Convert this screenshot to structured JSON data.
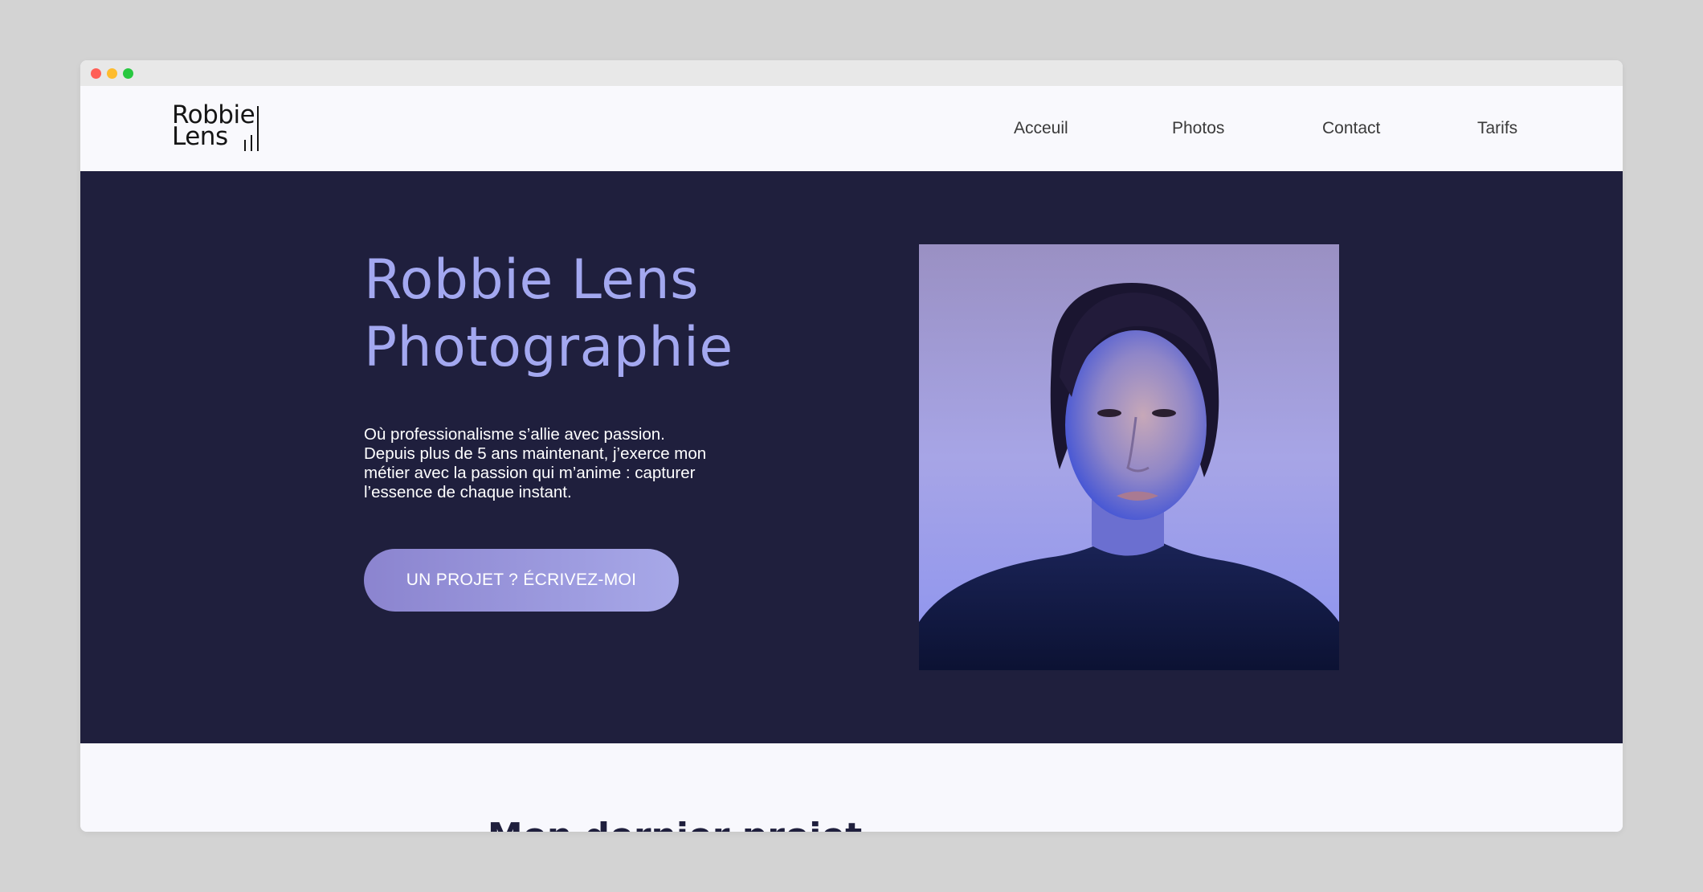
{
  "browser": {
    "controls": [
      "close",
      "minimize",
      "maximize"
    ],
    "colors": {
      "close": "#ff5f57",
      "minimize": "#febc2e",
      "maximize": "#28c840"
    }
  },
  "header": {
    "logo": {
      "line1": "Robbie",
      "line2": "Lens"
    },
    "nav": [
      {
        "label": "Acceuil"
      },
      {
        "label": "Photos"
      },
      {
        "label": "Contact"
      },
      {
        "label": "Tarifs"
      }
    ]
  },
  "hero": {
    "title_line1": "Robbie Lens",
    "title_line2": "Photographie",
    "description": "Où professionalisme s’allie avec passion. Depuis plus de 5 ans maintenant, j’exerce mon métier avec la passion qui m’anime : capturer l’essence de chaque instant.",
    "cta_label": "UN PROJET ? ÉCRIVEZ-MOI",
    "image_alt": "portrait"
  },
  "section": {
    "title": "Mon dernier projet"
  },
  "colors": {
    "hero_background": "#1f1f3d",
    "accent": "#a3a8f0",
    "page_background": "#f8f8fd"
  }
}
